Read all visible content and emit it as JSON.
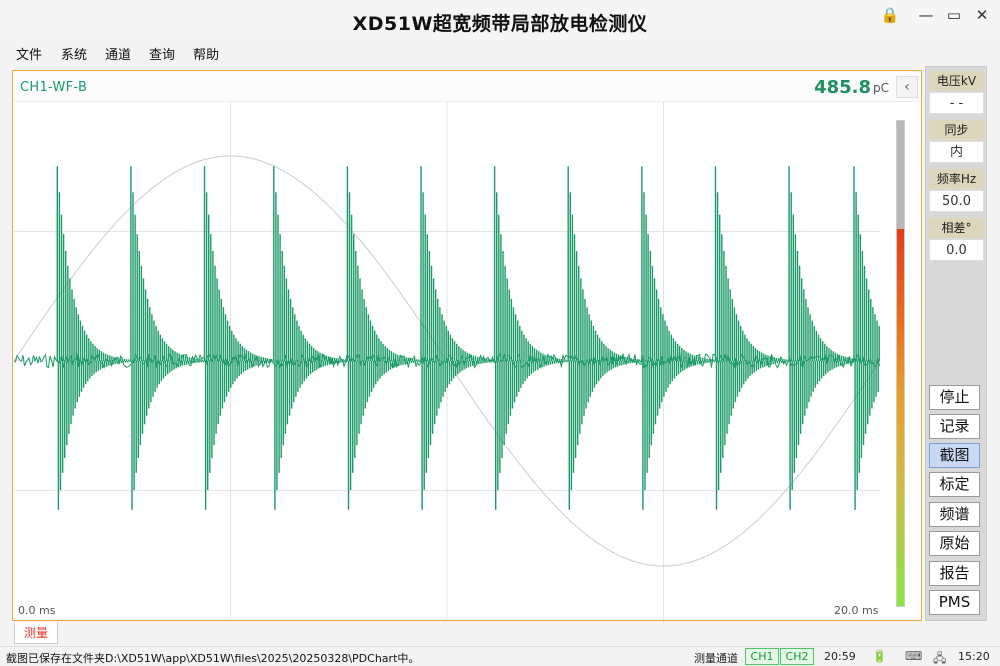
{
  "window": {
    "title": "XD51W超宽频带局部放电检测仪",
    "lock_icon": "🔒",
    "minimize_icon": "—",
    "restore_icon": "▭",
    "close_icon": "✕"
  },
  "menu": [
    "文件",
    "系统",
    "通道",
    "查询",
    "帮助"
  ],
  "chart": {
    "channel": "CH1-WF-B",
    "peak_value": "485.8",
    "peak_unit": "pC",
    "collapse_icon": "‹",
    "x_start_label": "0.0 ms",
    "x_end_label": "20.0 ms"
  },
  "chart_data": {
    "type": "line",
    "x_range": [
      0.0,
      20.0
    ],
    "x_unit": "ms",
    "sine": {
      "amplitude": 1.0,
      "cycles": 1,
      "color": "#cccccc"
    },
    "pulse_color": "#1a9a66",
    "pulses_ms": [
      1.0,
      2.7,
      4.4,
      6.0,
      7.7,
      9.4,
      11.1,
      12.8,
      14.5,
      16.2,
      17.9,
      19.4
    ],
    "pulse_peak_positive": 0.95,
    "pulse_peak_negative": 0.78,
    "noise_level": 0.03,
    "colorbar_colors": [
      "#b8b8b8",
      "#e33c1a",
      "#e9a02a",
      "#8fe543"
    ]
  },
  "side_panel": {
    "params": [
      {
        "label": "电压kV",
        "value": "- -"
      },
      {
        "label": "同步",
        "value": "内"
      },
      {
        "label": "频率Hz",
        "value": "50.0"
      },
      {
        "label": "相差°",
        "value": "0.0"
      }
    ],
    "buttons": [
      "停止",
      "记录",
      "截图",
      "标定",
      "频谱",
      "原始",
      "报告",
      "PMS"
    ]
  },
  "tab": {
    "label": "测量"
  },
  "status": {
    "message": "截图已保存在文件夹D:\\XD51W\\app\\XD51W\\files\\2025\\20250328\\PDChart中。",
    "channel_label": "测量通道",
    "ch1": "CH1",
    "ch2": "CH2",
    "time1": "20:59",
    "battery_icon": "🔋",
    "keyboard_icon": "⌨",
    "network_icon": "🖧",
    "time2": "15:20"
  }
}
